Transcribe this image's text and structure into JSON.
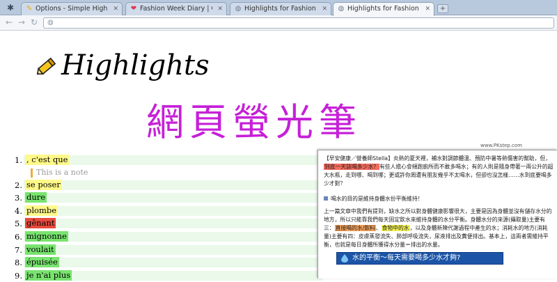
{
  "browser": {
    "tabs": [
      {
        "label": "Options - Simple Highlights",
        "icon": "pencil-icon",
        "color": "#f5c400"
      },
      {
        "label": "Fashion Week Diary | Garance",
        "icon": "heart-icon",
        "color": "#e0364f"
      },
      {
        "label": "Highlights for Fashion Week",
        "icon": "globe-icon",
        "color": "#6d7f95"
      },
      {
        "label": "Highlights for Fashion Week",
        "icon": "globe-icon",
        "color": "#6d7f95"
      }
    ],
    "active_tab": 3,
    "new_tab_label": "+"
  },
  "page": {
    "title": "Highlights",
    "headline": "網頁螢光筆",
    "headline_color": "#c620d8",
    "highlights": [
      {
        "num": "1.",
        "text": ", c'est que",
        "color": "#fff98a"
      },
      {
        "num": "2.",
        "text": "se poser",
        "color": "#fff98a"
      },
      {
        "num": "3.",
        "text": "dure",
        "color": "#79e36f"
      },
      {
        "num": "4.",
        "text": "plombe",
        "color": "#fff98a"
      },
      {
        "num": "5.",
        "text": "gênant",
        "color": "#e84a3e"
      },
      {
        "num": "6.",
        "text": "mignonne",
        "color": "#79e36f"
      },
      {
        "num": "7.",
        "text": "voulait",
        "color": "#79e36f"
      },
      {
        "num": "8.",
        "text": "épuisée",
        "color": "#79e36f"
      },
      {
        "num": "9.",
        "text": "je n'ai plus",
        "color": "#79e36f"
      }
    ],
    "note": "This is a note"
  },
  "inset": {
    "watermark": "www.PKstep.com",
    "p1_a": "【早安健康／營養師Stella】炎熱的夏天裡，補水對調節體溫、預防中暑等熱傷害的幫助，但，",
    "p1_mark": "到底一天該喝多少水？",
    "p1_b": "有些人擔心會頻跑廁所而不敢多喝水；有的人則是隨身帶著一兩公升的超大水瓶，走到哪、喝到哪；更或許你周遭有朋友幾乎不太喝水，但卻也沒怎樣……水到底要喝多少才對？",
    "sub": "喝水的目的是維持身體水份平衡維持！",
    "p2_a": "上一篇文章中我們有提到，缺水之所以對身體健康影響很大，主要是因為身體並沒有儲存水分的地方，所以只能靠我們每天固定飲水來維持身體的水分平衡。身體水分的來源(攝取量)主要有三：",
    "p2_mark1": "直接喝的水/飲料",
    "p2_mid": "、",
    "p2_mark2": "食物中的水",
    "p2_b": "，以及身體新陳代謝過程中產生的水；消耗水的地方(消耗量)主要有四：皮膚蒸發流失、肺部呼吸流失，尿液排出及糞便排出。基本上，這兩者需維持平衡，也就是每日身體所獲得水分量＝排出的水量。",
    "banner": "水的平衡～每天需要喝多少水才夠?",
    "mark_red": "#f46b5c",
    "mark_orange": "#f6a25a",
    "mark_yellow": "#f4f252"
  }
}
